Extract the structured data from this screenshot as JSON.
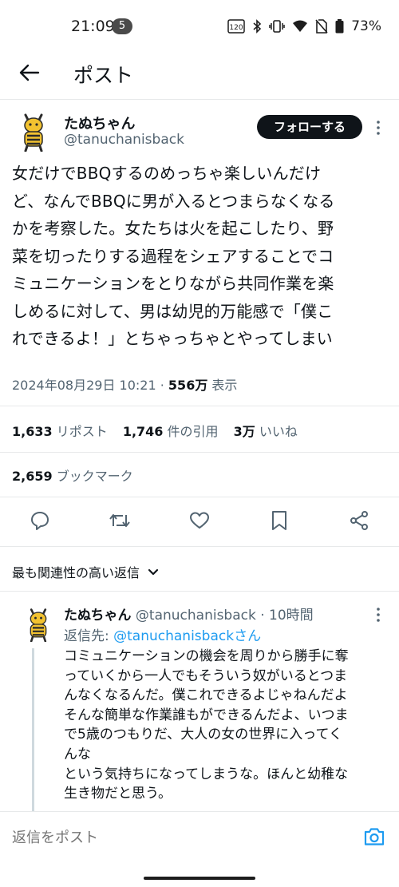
{
  "status_bar": {
    "time": "21:09",
    "notification_count": "5",
    "data_icon_label": "120",
    "battery": "73%"
  },
  "header": {
    "title": "ポスト"
  },
  "tweet": {
    "author_name": "たぬちゃん",
    "author_handle": "@tanuchanisback",
    "follow_label": "フォローする",
    "text": "女だけでBBQするのめっちゃ楽しいんだけ\nど、なんでBBQに男が入るとつまらなくなる\nかを考察した。女たちは火を起こしたり、野\n菜を切ったりする過程をシェアすることでコ\nミュニケーションをとりながら共同作業を楽\nしめるに対して、男は幼児的万能感で「僕こ\nれできるよ！」とちゃっちゃとやってしまい",
    "timestamp": "2024年08月29日 10:21",
    "separator": "·",
    "views_count": "556万",
    "views_label": "表示",
    "reposts_count": "1,633",
    "reposts_label": "リポスト",
    "quotes_count": "1,746",
    "quotes_label": "件の引用",
    "likes_count": "3万",
    "likes_label": "いいね",
    "bookmarks_count": "2,659",
    "bookmarks_label": "ブックマーク"
  },
  "actions": [
    "reply-icon",
    "retweet-icon",
    "like-icon",
    "bookmark-icon",
    "share-icon"
  ],
  "replies": {
    "sort_label": "最も関連性の高い返信"
  },
  "reply": {
    "name": "たぬちゃん",
    "handle_time": "@tanuchanisback · 10時間",
    "replying_prefix": "返信先: ",
    "replying_to": "@tanuchanisbackさん",
    "text": "コミュニケーションの機会を周りから勝手に奪\nっていくから一人でもそういう奴がいるとつま\nんなくなるんだ。僕これできるよじゃねんだよ\nそんな簡単な作業誰もができるんだよ、いつま\nで5歳のつもりだ、大人の女の世界に入ってく\nんな\nという気持ちになってしまうな。ほんと幼稚な\n生き物だと思う。"
  },
  "compose": {
    "placeholder": "返信をポスト"
  },
  "colors": {
    "text_primary": "#0f1419",
    "text_secondary": "#536471",
    "accent": "#1d9bf0",
    "divider": "#e7e9ea"
  }
}
